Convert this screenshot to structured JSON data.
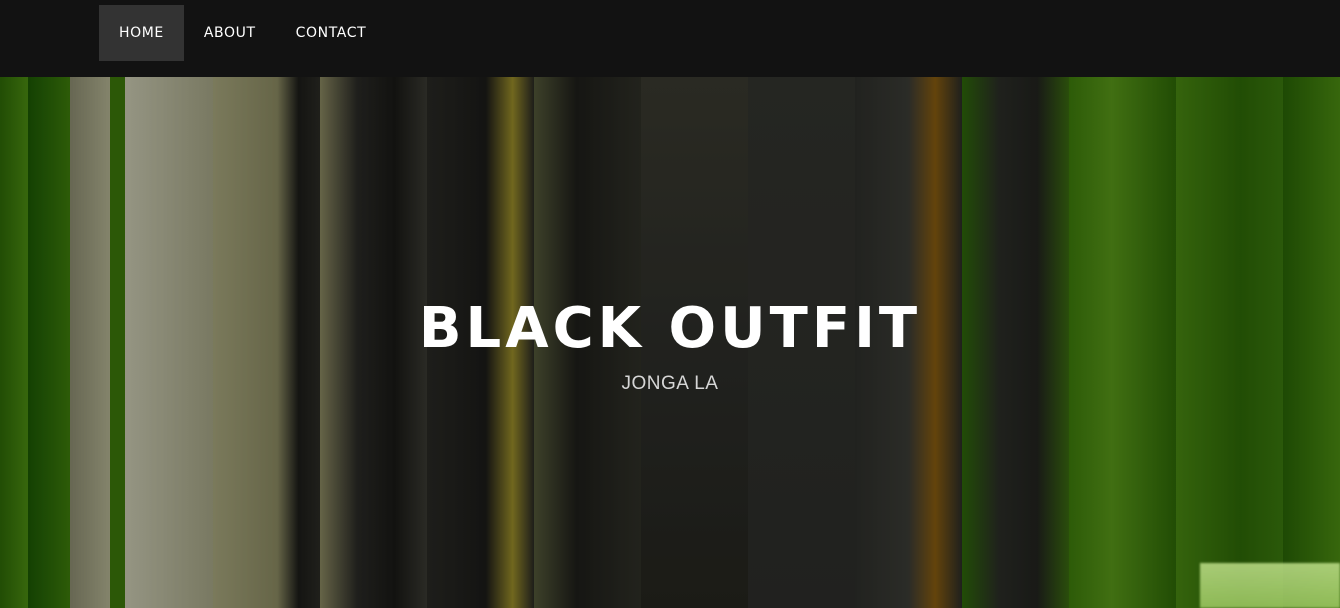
{
  "nav": {
    "items": [
      {
        "label": "HOME",
        "active": true
      },
      {
        "label": "ABOUT",
        "active": false
      },
      {
        "label": "CONTACT",
        "active": false
      }
    ]
  },
  "hero": {
    "title": "BLACK OUTFIT",
    "subtitle": "JONGA LA"
  },
  "colors": {
    "navbar_bg": "#121212",
    "active_tab_bg": "#333333",
    "hero_green": "#3f7f0c",
    "text_white": "#ffffff"
  }
}
